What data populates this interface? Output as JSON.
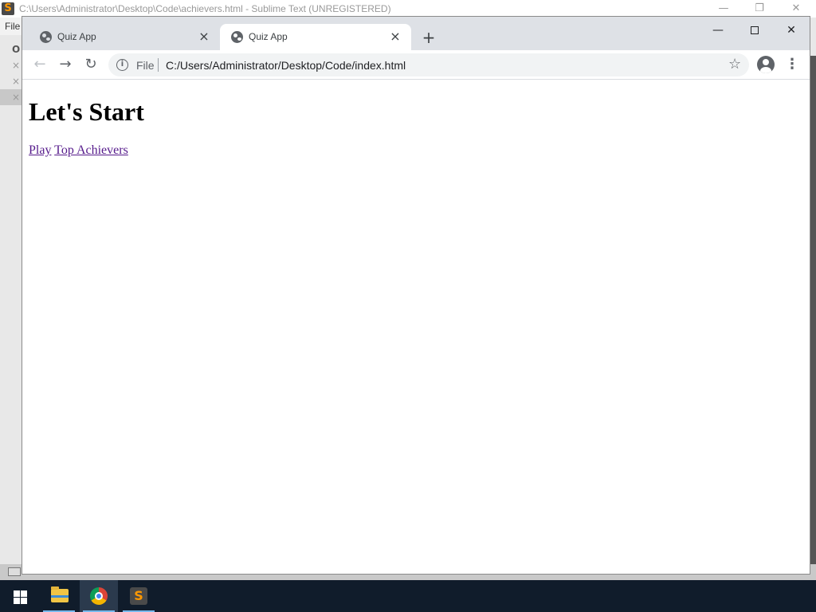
{
  "sublime": {
    "title": "C:\\Users\\Administrator\\Desktop\\Code\\achievers.html - Sublime Text (UNREGISTERED)",
    "logo_glyph": "S",
    "menu_file": "File",
    "sidebar_header": "O",
    "close_glyph": "×",
    "win_minimize": "—",
    "win_restore": "❐",
    "win_close": "✕"
  },
  "chrome": {
    "tabs": [
      {
        "title": "Quiz App",
        "active": false
      },
      {
        "title": "Quiz App",
        "active": true
      }
    ],
    "tab_close_glyph": "×",
    "newtab_glyph": "+",
    "win_minimize": "—",
    "win_close": "✕",
    "nav": {
      "back": "←",
      "forward": "→",
      "reload": "↻"
    },
    "omnibox": {
      "info_glyph": "i",
      "scheme": "File",
      "url": "C:/Users/Administrator/Desktop/Code/index.html"
    },
    "star_glyph": "☆",
    "menu_glyph": "⋮"
  },
  "page": {
    "heading": "Let's Start",
    "links": [
      "Play",
      "Top Achievers"
    ],
    "link_color": "#551a8b"
  },
  "taskbar": {
    "apps": [
      "file-explorer",
      "chrome",
      "sublime-text"
    ],
    "sublime_logo_glyph": "S"
  }
}
